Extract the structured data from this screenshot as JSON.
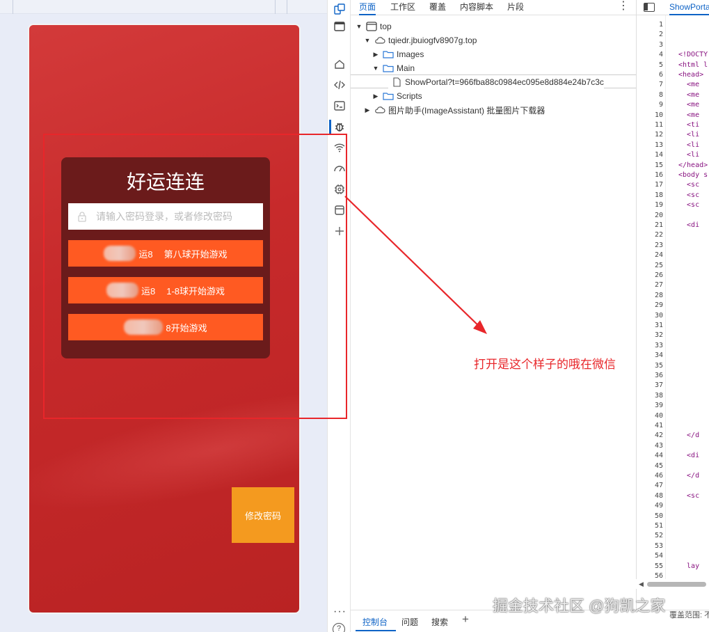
{
  "page": {
    "title": "好运连连",
    "password_placeholder": "请输入密码登录，或者修改密码",
    "buttons": [
      {
        "label_prefix": "运8",
        "label_main": "第八球开始游戏"
      },
      {
        "label_prefix": "运8",
        "label_main": "1-8球开始游戏"
      },
      {
        "label_prefix": "",
        "label_main": "8开始游戏"
      }
    ],
    "change_password_label": "修改密码"
  },
  "annotation": {
    "text": "打开是这个样子的哦在微信"
  },
  "devtools": {
    "tabs": [
      "页面",
      "工作区",
      "覆盖",
      "内容脚本",
      "片段"
    ],
    "active_tab": "页面",
    "tree": {
      "top": "top",
      "domain": "tqiedr.jbuiogfv8907g.top",
      "images": "Images",
      "main": "Main",
      "file": "ShowPortal?t=966fba88c0984ec095e8d884e24b7c3c",
      "scripts": "Scripts",
      "extension": "图片助手(ImageAssistant) 批量图片下载器"
    },
    "source_tab": "ShowPorta",
    "drawer_tabs": [
      "控制台",
      "问题",
      "搜索"
    ],
    "scope_text": "覆盖范围: 不"
  },
  "code_lines": [
    {
      "n": "1",
      "t": ""
    },
    {
      "n": "2",
      "t": ""
    },
    {
      "n": "3",
      "t": ""
    },
    {
      "n": "4",
      "t": "<!DOCTY"
    },
    {
      "n": "5",
      "t": "<html l"
    },
    {
      "n": "6",
      "t": "<head>"
    },
    {
      "n": "7",
      "t": "  <me"
    },
    {
      "n": "8",
      "t": "  <me"
    },
    {
      "n": "9",
      "t": "  <me"
    },
    {
      "n": "10",
      "t": "  <me"
    },
    {
      "n": "11",
      "t": "  <ti"
    },
    {
      "n": "12",
      "t": "  <li"
    },
    {
      "n": "13",
      "t": "  <li"
    },
    {
      "n": "14",
      "t": "  <li"
    },
    {
      "n": "15",
      "t": "</head>"
    },
    {
      "n": "16",
      "t": "<body s"
    },
    {
      "n": "17",
      "t": "  <sc"
    },
    {
      "n": "18",
      "t": "  <sc"
    },
    {
      "n": "19",
      "t": "  <sc"
    },
    {
      "n": "20",
      "t": ""
    },
    {
      "n": "21",
      "t": "  <di"
    },
    {
      "n": "22",
      "t": ""
    },
    {
      "n": "23",
      "t": ""
    },
    {
      "n": "24",
      "t": ""
    },
    {
      "n": "25",
      "t": ""
    },
    {
      "n": "26",
      "t": ""
    },
    {
      "n": "27",
      "t": ""
    },
    {
      "n": "28",
      "t": ""
    },
    {
      "n": "29",
      "t": ""
    },
    {
      "n": "30",
      "t": ""
    },
    {
      "n": "31",
      "t": ""
    },
    {
      "n": "32",
      "t": ""
    },
    {
      "n": "33",
      "t": ""
    },
    {
      "n": "34",
      "t": ""
    },
    {
      "n": "35",
      "t": ""
    },
    {
      "n": "36",
      "t": ""
    },
    {
      "n": "37",
      "t": ""
    },
    {
      "n": "38",
      "t": ""
    },
    {
      "n": "39",
      "t": ""
    },
    {
      "n": "40",
      "t": ""
    },
    {
      "n": "41",
      "t": ""
    },
    {
      "n": "42",
      "t": "  </d"
    },
    {
      "n": "43",
      "t": ""
    },
    {
      "n": "44",
      "t": "  <di"
    },
    {
      "n": "45",
      "t": ""
    },
    {
      "n": "46",
      "t": "  </d"
    },
    {
      "n": "47",
      "t": ""
    },
    {
      "n": "48",
      "t": "  <sc"
    },
    {
      "n": "49",
      "t": ""
    },
    {
      "n": "50",
      "t": ""
    },
    {
      "n": "51",
      "t": ""
    },
    {
      "n": "52",
      "t": ""
    },
    {
      "n": "53",
      "t": ""
    },
    {
      "n": "54",
      "t": ""
    },
    {
      "n": "55",
      "t": "  lay"
    },
    {
      "n": "56",
      "t": ""
    }
  ],
  "watermark": "掘金技术社区 @狗凯之家",
  "colors": {
    "annotation_red": "#e8262a",
    "button_orange": "#ff5a22",
    "change_pwd_orange": "#f49a1f",
    "devtools_blue": "#0e63c6"
  }
}
